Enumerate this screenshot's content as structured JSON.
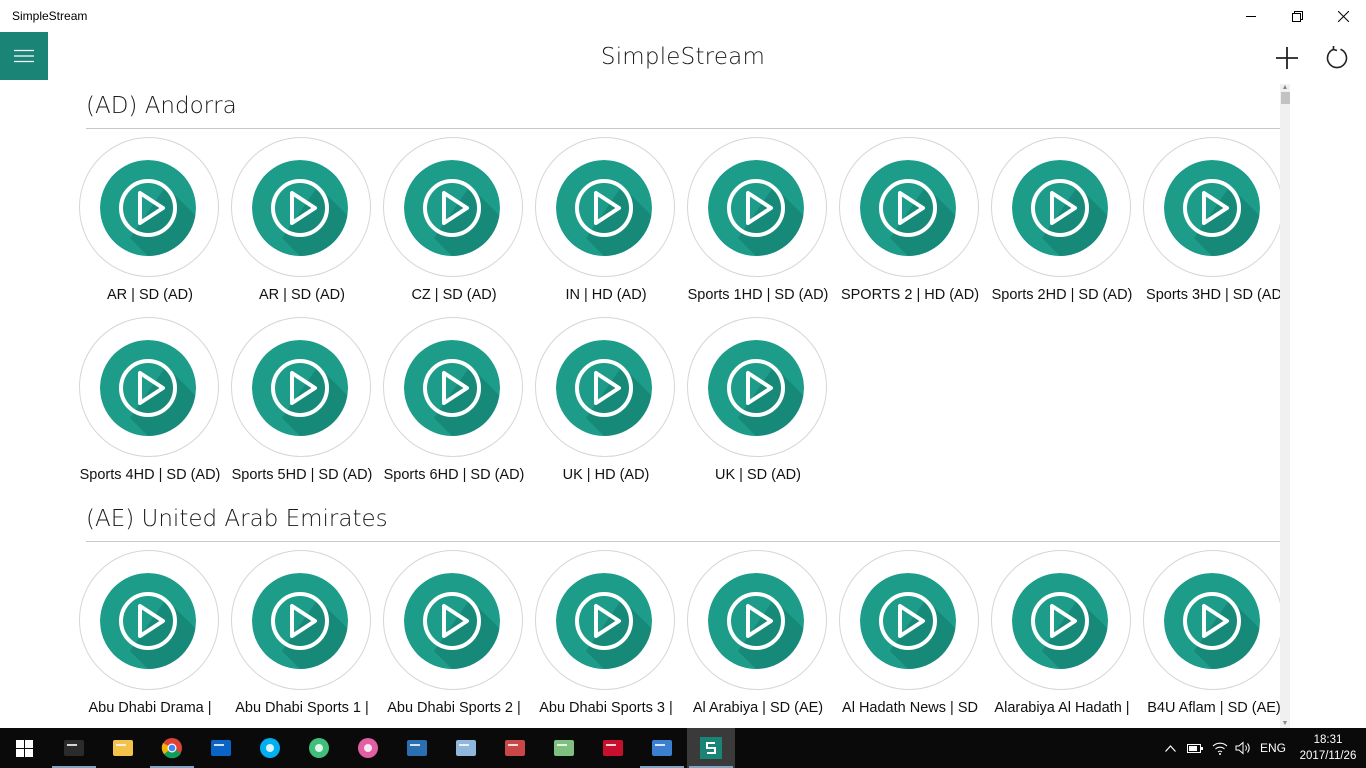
{
  "window": {
    "title": "SimpleStream"
  },
  "app": {
    "title": "SimpleStream"
  },
  "sections": [
    {
      "title": "(AD) Andorra",
      "channels": [
        "AR | SD (AD)",
        "AR | SD (AD)",
        "CZ | SD (AD)",
        "IN | HD (AD)",
        "Sports 1HD | SD (AD)",
        "SPORTS 2 | HD (AD)",
        "Sports 2HD | SD (AD)",
        "Sports 3HD | SD (AD",
        "Sports 4HD | SD (AD)",
        "Sports 5HD | SD (AD)",
        "Sports 6HD | SD (AD)",
        "UK | HD (AD)",
        "UK | SD (AD)"
      ]
    },
    {
      "title": "(AE) United Arab Emirates",
      "channels": [
        "Abu Dhabi Drama |",
        "Abu Dhabi Sports 1 |",
        "Abu Dhabi Sports 2 |",
        "Abu Dhabi Sports 3 |",
        "Al Arabiya | SD (AE)",
        "Al Hadath News | SD",
        "Alarabiya Al Hadath |",
        "B4U Aflam | SD (AE)"
      ]
    }
  ],
  "colors": {
    "accent": "#1a8477",
    "disc": "#1d9c8a",
    "disc_shadow": "#137a6c"
  },
  "icons": {
    "menu": "hamburger-icon",
    "add": "plus-icon",
    "refresh": "refresh-icon",
    "play": "play-icon",
    "minimize": "minimize-icon",
    "restore": "restore-icon",
    "close": "close-icon"
  },
  "taskbar": {
    "apps": [
      "command-prompt",
      "file-explorer",
      "chrome",
      "outlook",
      "skype",
      "atom",
      "itunes",
      "powershell",
      "notepad",
      "snipping-tool",
      "task-manager",
      "filezilla",
      "store",
      "simplestream"
    ],
    "language": "ENG",
    "time": "18:31",
    "date": "2017/11/26"
  }
}
